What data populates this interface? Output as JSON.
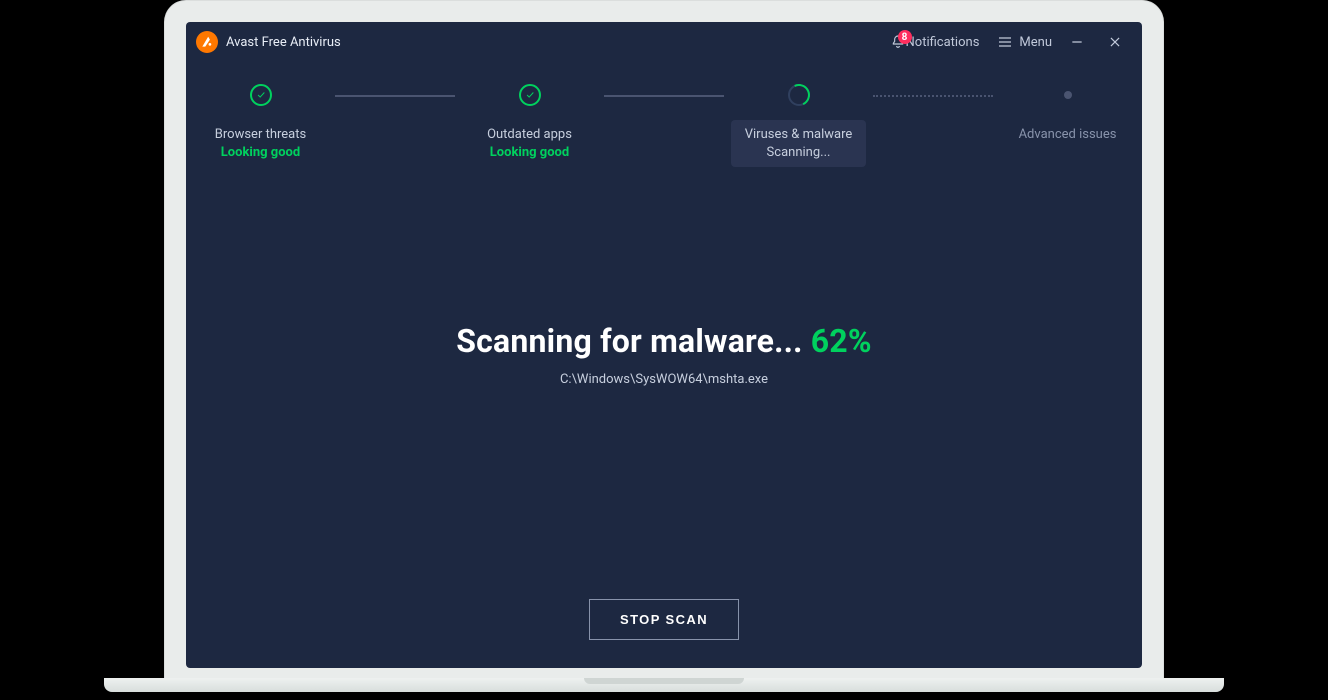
{
  "titlebar": {
    "app_name": "Avast Free Antivirus",
    "notifications_label": "Notifications",
    "notifications_count": "8",
    "menu_label": "Menu"
  },
  "steps": {
    "browser": {
      "label": "Browser threats",
      "status": "Looking good"
    },
    "apps": {
      "label": "Outdated apps",
      "status": "Looking good"
    },
    "viruses": {
      "label": "Viruses & malware",
      "status": "Scanning..."
    },
    "advanced": {
      "label": "Advanced issues"
    }
  },
  "main": {
    "headline_prefix": "Scanning for malware... ",
    "percent": "62%",
    "current_path": "C:\\Windows\\SysWOW64\\mshta.exe"
  },
  "actions": {
    "stop": "STOP SCAN"
  },
  "colors": {
    "accent": "#ff7800",
    "good": "#00d15e",
    "bg": "#1d2841",
    "badge": "#ff2e5e"
  }
}
